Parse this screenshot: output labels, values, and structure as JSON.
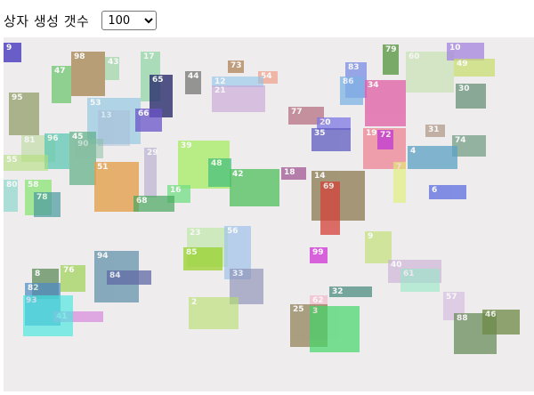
{
  "controls": {
    "count_label": "상자 생성 갯수",
    "count_selected": "100"
  },
  "boxes": [
    {
      "label": "9",
      "color": "#5b4fc4"
    },
    {
      "label": "98",
      "color": "#a7854f"
    },
    {
      "label": "43",
      "color": "#9fd6a8"
    },
    {
      "label": "47",
      "color": "#67c36a"
    },
    {
      "label": "17",
      "color": "#7dd397"
    },
    {
      "label": "65",
      "color": "#2b2e6e"
    },
    {
      "label": "44",
      "color": "#7e7f7c"
    },
    {
      "label": "73",
      "color": "#b58b62"
    },
    {
      "label": "54",
      "color": "#f0a08a"
    },
    {
      "label": "12",
      "color": "#8fc6ec"
    },
    {
      "label": "21",
      "color": "#c9a4d6"
    },
    {
      "label": "79",
      "color": "#5e9a46"
    },
    {
      "label": "60",
      "color": "#bfe0a8"
    },
    {
      "label": "10",
      "color": "#a584e0"
    },
    {
      "label": "49",
      "color": "#c9de6a"
    },
    {
      "label": "83",
      "color": "#7a8ee6"
    },
    {
      "label": "86",
      "color": "#7fb3e4"
    },
    {
      "label": "34",
      "color": "#e05ea4"
    },
    {
      "label": "30",
      "color": "#5f8c72"
    },
    {
      "label": "95",
      "color": "#8d9a63"
    },
    {
      "label": "53",
      "color": "#8fc8e2"
    },
    {
      "label": "13",
      "color": "#a7bbd8"
    },
    {
      "label": "66",
      "color": "#6a54c8"
    },
    {
      "label": "77",
      "color": "#b46a7c"
    },
    {
      "label": "20",
      "color": "#7d78e4"
    },
    {
      "label": "35",
      "color": "#5f5cc0"
    },
    {
      "label": "19",
      "color": "#ef7e8e"
    },
    {
      "label": "72",
      "color": "#c33fd0"
    },
    {
      "label": "31",
      "color": "#b8a092"
    },
    {
      "label": "74",
      "color": "#6d9a80"
    },
    {
      "label": "81",
      "color": "#b7d996"
    },
    {
      "label": "96",
      "color": "#57c6b2"
    },
    {
      "label": "45",
      "color": "#5faf88"
    },
    {
      "label": "90",
      "color": "#88bda0"
    },
    {
      "label": "29",
      "color": "#b3a9cf"
    },
    {
      "label": "39",
      "color": "#a7ec62"
    },
    {
      "label": "4",
      "color": "#5aa1c4"
    },
    {
      "label": "55",
      "color": "#b4e07c"
    },
    {
      "label": "51",
      "color": "#e3a04d"
    },
    {
      "label": "48",
      "color": "#48c07e"
    },
    {
      "label": "42",
      "color": "#4fc15c"
    },
    {
      "label": "18",
      "color": "#a6629a"
    },
    {
      "label": "14",
      "color": "#8b7a4f"
    },
    {
      "label": "69",
      "color": "#d4423a"
    },
    {
      "label": "7",
      "color": "#e0f26c"
    },
    {
      "label": "80",
      "color": "#7fd6c8"
    },
    {
      "label": "58",
      "color": "#84e670"
    },
    {
      "label": "78",
      "color": "#4a9aa0"
    },
    {
      "label": "16",
      "color": "#73de86"
    },
    {
      "label": "68",
      "color": "#48a860"
    },
    {
      "label": "6",
      "color": "#5d6ee0"
    },
    {
      "label": "23",
      "color": "#b8e89e"
    },
    {
      "label": "56",
      "color": "#9cc0ec"
    },
    {
      "label": "85",
      "color": "#9ad22e"
    },
    {
      "label": "9",
      "color": "#c8e282"
    },
    {
      "label": "99",
      "color": "#d449d8"
    },
    {
      "label": "94",
      "color": "#5b8ea6"
    },
    {
      "label": "8",
      "color": "#5e8e5c"
    },
    {
      "label": "76",
      "color": "#a4d45e"
    },
    {
      "label": "84",
      "color": "#616aa6"
    },
    {
      "label": "33",
      "color": "#8c8fb6"
    },
    {
      "label": "40",
      "color": "#cfb5d8"
    },
    {
      "label": "61",
      "color": "#96e9c6"
    },
    {
      "label": "32",
      "color": "#4e8e82"
    },
    {
      "label": "82",
      "color": "#4d8bc3"
    },
    {
      "label": "41",
      "color": "#da8adc"
    },
    {
      "label": "93",
      "color": "#46e8e0"
    },
    {
      "label": "2",
      "color": "#b6e06a"
    },
    {
      "label": "62",
      "color": "#f2b2c6"
    },
    {
      "label": "25",
      "color": "#8e7e53"
    },
    {
      "label": "3",
      "color": "#44d86a"
    },
    {
      "label": "57",
      "color": "#d4b8e0"
    },
    {
      "label": "88",
      "color": "#6b8e5c"
    },
    {
      "label": "46",
      "color": "#6e8a46"
    }
  ]
}
